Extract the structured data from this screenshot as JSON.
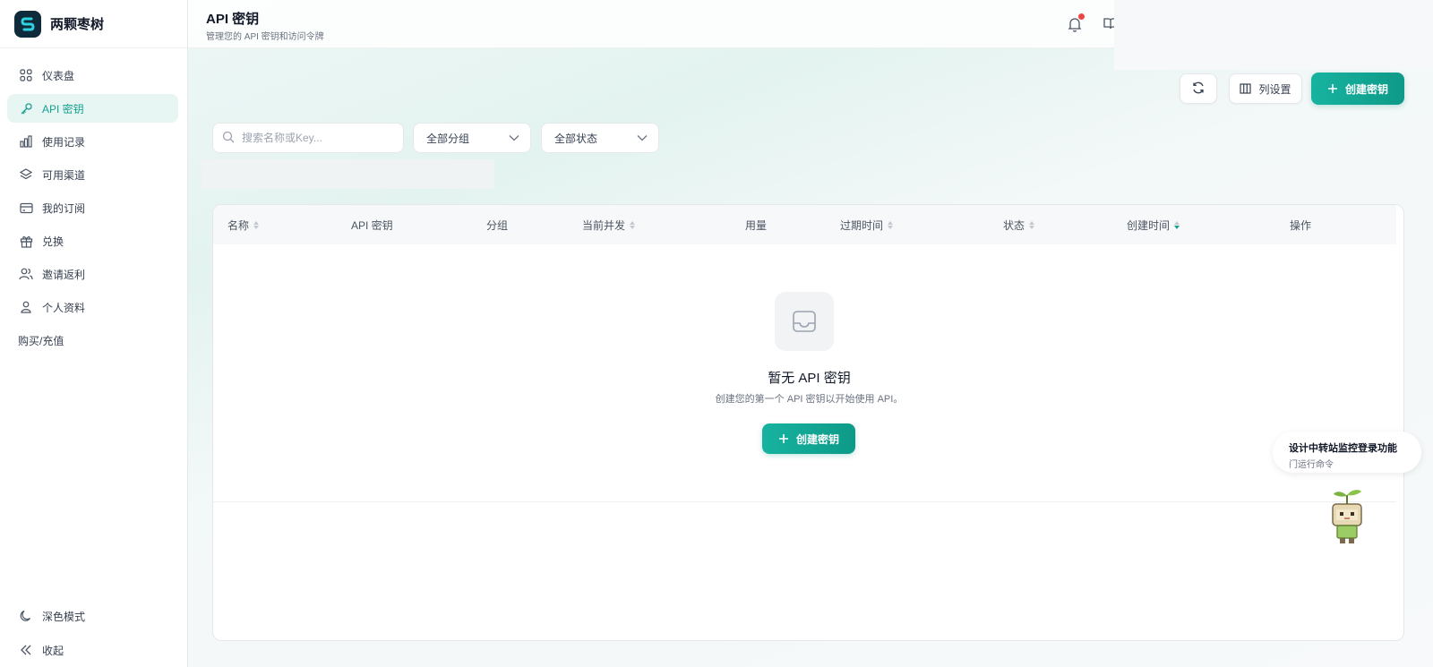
{
  "brand": {
    "name": "两颗枣树"
  },
  "sidebar": {
    "items": [
      {
        "label": "仪表盘",
        "icon": "grid-icon"
      },
      {
        "label": "API 密钥",
        "icon": "key-icon",
        "active": true
      },
      {
        "label": "使用记录",
        "icon": "bar-chart-icon"
      },
      {
        "label": "可用渠道",
        "icon": "layers-icon"
      },
      {
        "label": "我的订阅",
        "icon": "card-icon"
      },
      {
        "label": "兑换",
        "icon": "gift-icon"
      },
      {
        "label": "邀请返利",
        "icon": "users-icon"
      },
      {
        "label": "个人资料",
        "icon": "user-icon"
      },
      {
        "label": "购买/充值",
        "icon": ""
      }
    ],
    "dark_mode_label": "深色模式",
    "collapse_label": "收起"
  },
  "header": {
    "title": "API 密钥",
    "subtitle": "管理您的 API 密钥和访问令牌"
  },
  "toolbar": {
    "columns_label": "列设置",
    "create_label": "创建密钥"
  },
  "filters": {
    "search_placeholder": "搜索名称或Key...",
    "group_value": "全部分组",
    "status_value": "全部状态"
  },
  "table": {
    "columns": [
      "名称",
      "API 密钥",
      "分组",
      "当前并发",
      "用量",
      "过期时间",
      "状态",
      "创建时间",
      "操作"
    ],
    "rows": [],
    "empty_title": "暂无 API 密钥",
    "empty_desc": "创建您的第一个 API 密钥以开始使用 API。",
    "empty_create_label": "创建密钥"
  },
  "assistant": {
    "line1": "设计中转站监控登录功能",
    "line2": "门运行命令"
  },
  "colors": {
    "accent": "#14a18f",
    "notification_dot": "#ef4444"
  }
}
